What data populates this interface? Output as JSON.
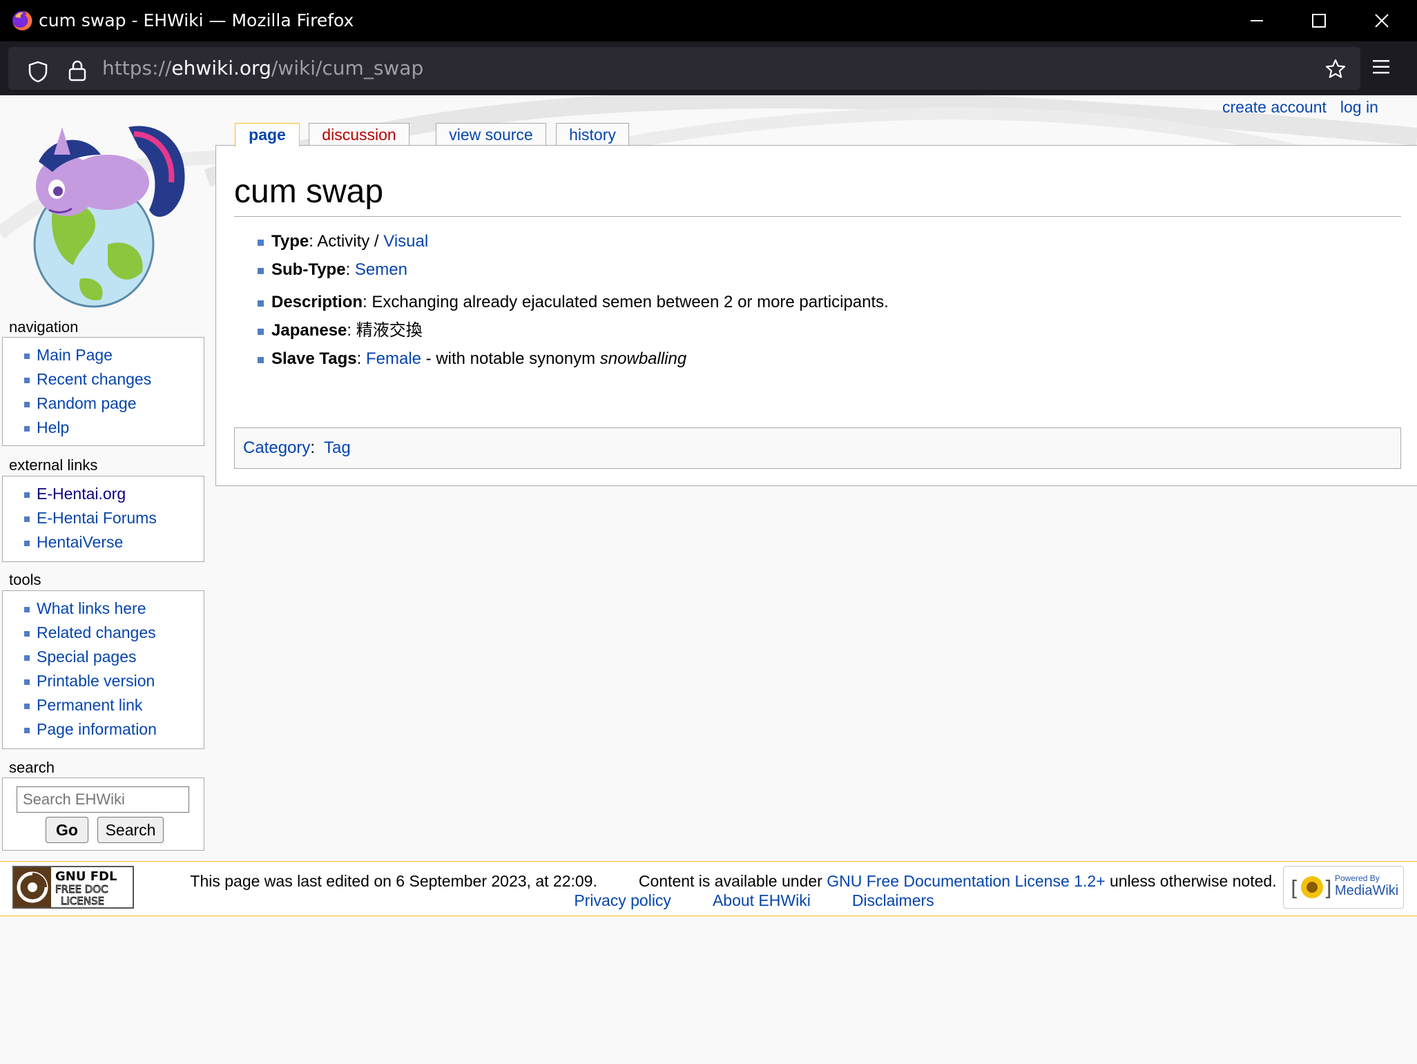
{
  "window": {
    "title": "cum swap - EHWiki — Mozilla Firefox"
  },
  "urlbar": {
    "scheme": "https://",
    "host": "ehwiki.org",
    "path": "/wiki/cum_swap"
  },
  "personal": {
    "create_account": "create account",
    "log_in": "log in"
  },
  "tabs": [
    {
      "label": "page",
      "selected": true
    },
    {
      "label": "discussion",
      "selected": false
    },
    {
      "label": "view source",
      "selected": false
    },
    {
      "label": "history",
      "selected": false
    }
  ],
  "article": {
    "title": "cum swap",
    "type_label": "Type",
    "type_value": "Activity / ",
    "type_link": "Visual",
    "subtype_label": "Sub-Type",
    "subtype_link": "Semen",
    "description_label": "Description",
    "description_value": "Exchanging already ejaculated semen between 2 or more participants.",
    "japanese_label": "Japanese",
    "japanese_value": "精液交換",
    "slave_label": "Slave Tags",
    "slave_link": "Female",
    "slave_rest": " - with notable synonym ",
    "slave_synonym": "snowballing",
    "category_label": "Category",
    "category_value": "Tag"
  },
  "sidebar": {
    "navigation": {
      "title": "navigation",
      "items": [
        "Main Page",
        "Recent changes",
        "Random page",
        "Help"
      ]
    },
    "external": {
      "title": "external links",
      "items": [
        "E-Hentai.org",
        "E-Hentai Forums",
        "HentaiVerse"
      ]
    },
    "tools": {
      "title": "tools",
      "items": [
        "What links here",
        "Related changes",
        "Special pages",
        "Printable version",
        "Permanent link",
        "Page information"
      ]
    },
    "search": {
      "title": "search",
      "placeholder": "Search EHWiki",
      "go": "Go",
      "search": "Search"
    }
  },
  "footer": {
    "edited": "This page was last edited on 6 September 2023, at 22:09.",
    "content_pre": "Content is available under",
    "license": "GNU Free Documentation License 1.2+",
    "content_post": "unless otherwise noted.",
    "privacy": "Privacy policy",
    "about": "About EHWiki",
    "disclaimers": "Disclaimers",
    "gfdl_badge": [
      "GNU FDL",
      "FREE DOC",
      "LICENSE"
    ],
    "mw_badge": {
      "small": "Powered By",
      "big": "MediaWiki"
    }
  },
  "icons": {
    "firefox": "firefox-logo-icon",
    "shield": "shield-icon",
    "lock": "lock-icon",
    "star": "bookmark-star-icon",
    "menu": "hamburger-menu-icon"
  },
  "colors": {
    "link": "#0645ad",
    "new_link": "#ba0000",
    "tab_highlight": "#fabd23",
    "chrome": "#000000",
    "urlbar": "#2b2a33"
  }
}
